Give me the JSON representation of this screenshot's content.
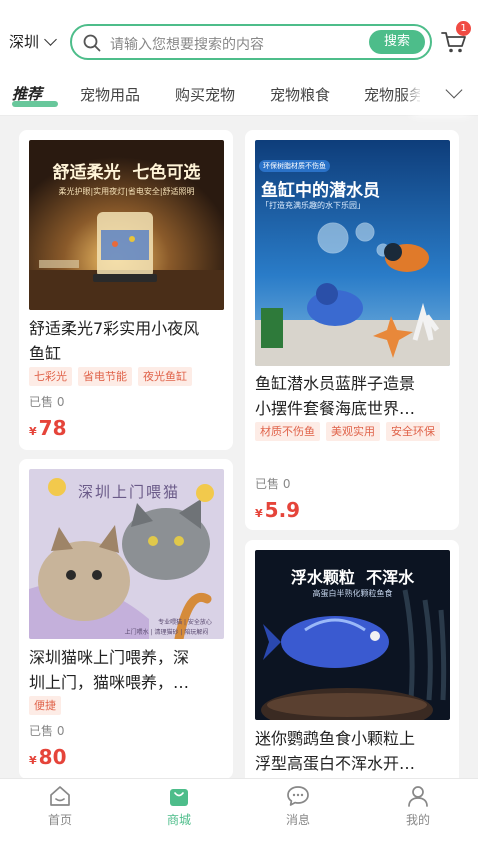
{
  "header": {
    "city": "深圳",
    "search_placeholder": "请输入您想要搜索的内容",
    "search_button": "搜索",
    "cart_badge": "1"
  },
  "tabs": [
    {
      "label": "推荐",
      "active": true
    },
    {
      "label": "宠物用品",
      "active": false
    },
    {
      "label": "购买宠物",
      "active": false
    },
    {
      "label": "宠物粮食",
      "active": false
    },
    {
      "label": "宠物服务",
      "active": false
    }
  ],
  "products": [
    {
      "title": "舒适柔光7彩实用小夜风鱼缸",
      "title_line1": "舒适柔光7彩实用小夜风",
      "title_line2": "鱼缸",
      "tags": [
        "七彩光",
        "省电节能",
        "夜光鱼缸"
      ],
      "sold": "已售 0",
      "price_currency": "¥",
      "price": "78",
      "image": {
        "headline": "舒适柔光  七色可选",
        "sub": "柔光护眼|实用夜灯|省电安全|舒适照明"
      }
    },
    {
      "title": "鱼缸潜水员蓝胖子造景小摆件套餐海底世界…",
      "title_line1": "鱼缸潜水员蓝胖子造景",
      "title_line2": "小摆件套餐海底世界…",
      "tags": [
        "材质不伤鱼",
        "美观实用",
        "安全环保"
      ],
      "sold": "已售 0",
      "price_currency": "¥",
      "price": "5.9",
      "image": {
        "badge": "环保树脂材质不伤鱼",
        "headline": "鱼缸中的潜水员",
        "sub": "「打造充满乐趣的水下乐园」"
      }
    },
    {
      "title": "深圳猫咪上门喂养，深圳上门，猫咪喂养，…",
      "title_line1": "深圳猫咪上门喂养，深",
      "title_line2": "圳上门，猫咪喂养，…",
      "tags": [
        "便捷"
      ],
      "sold": "已售 0",
      "price_currency": "¥",
      "price": "80",
      "image": {
        "headline": "深圳上门喂猫",
        "sub1": "专业喂猫 | 安全放心",
        "sub2": "上门喂水 | 清理猫砂 | 陪玩解闷"
      }
    },
    {
      "title": "迷你鹦鹉鱼食小颗粒上浮型高蛋白不浑水开…",
      "title_line1": "迷你鹦鹉鱼食小颗粒上",
      "title_line2": "浮型高蛋白不浑水开…",
      "tags": [],
      "image": {
        "headline": "浮水颗粒  不浑水",
        "sub": "高蛋白半熟化颗粒鱼食"
      }
    }
  ],
  "bottom_nav": [
    {
      "label": "首页",
      "icon": "home-icon",
      "active": false
    },
    {
      "label": "商城",
      "icon": "shop-bag-icon",
      "active": true
    },
    {
      "label": "消息",
      "icon": "message-icon",
      "active": false
    },
    {
      "label": "我的",
      "icon": "user-icon",
      "active": false
    }
  ],
  "colors": {
    "accent": "#4dbd8a",
    "price": "#e5443a",
    "tag_bg": "#fdece6",
    "tag_text": "#e0634a",
    "badge": "#f04b43"
  }
}
